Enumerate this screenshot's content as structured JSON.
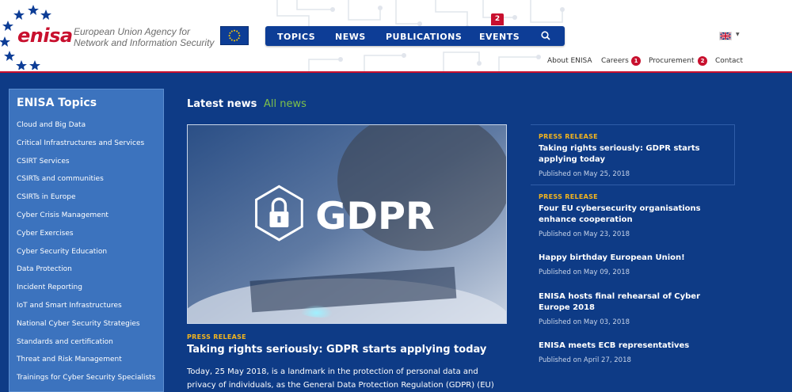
{
  "header": {
    "logo_text": "enisa",
    "tagline_line1": "European Union Agency for",
    "tagline_line2": "Network and Information Security",
    "nav": [
      {
        "label": "TOPICS"
      },
      {
        "label": "NEWS"
      },
      {
        "label": "PUBLICATIONS"
      },
      {
        "label": "EVENTS",
        "badge": "2"
      }
    ],
    "util_nav": [
      {
        "label": "About ENISA"
      },
      {
        "label": "Careers",
        "badge": "1"
      },
      {
        "label": "Procurement",
        "badge": "2"
      },
      {
        "label": "Contact"
      }
    ]
  },
  "sidebar": {
    "title": "ENISA Topics",
    "items": [
      "Cloud and Big Data",
      "Critical Infrastructures and Services",
      "CSIRT Services",
      "CSIRTs and communities",
      "CSIRTs in Europe",
      "Cyber Crisis Management",
      "Cyber Exercises",
      "Cyber Security Education",
      "Data Protection",
      "Incident Reporting",
      "IoT and Smart Infrastructures",
      "National Cyber Security Strategies",
      "Standards and certification",
      "Threat and Risk Management",
      "Trainings for Cyber Security Specialists"
    ]
  },
  "latest": {
    "title": "Latest news",
    "all_news_label": "All news",
    "hero_image_text": "GDPR",
    "hero_tag": "PRESS RELEASE",
    "hero_title": "Taking rights seriously: GDPR starts applying today",
    "hero_text": "Today, 25 May 2018, is a landmark in the protection of personal data and privacy of individuals, as the General Data Protection Regulation (GDPR) (EU)"
  },
  "news": [
    {
      "tag": "PRESS RELEASE",
      "title": "Taking rights seriously: GDPR starts applying today",
      "date": "Published on May 25, 2018"
    },
    {
      "tag": "PRESS RELEASE",
      "title": "Four EU cybersecurity organisations enhance cooperation",
      "date": "Published on May 23, 2018"
    },
    {
      "tag": "",
      "title": "Happy birthday European Union!",
      "date": "Published on May 09, 2018"
    },
    {
      "tag": "",
      "title": "ENISA hosts final rehearsal of Cyber Europe 2018",
      "date": "Published on May 03, 2018"
    },
    {
      "tag": "",
      "title": "ENISA meets ECB representatives",
      "date": "Published on April 27, 2018"
    }
  ],
  "colors": {
    "brand_red": "#c8102e",
    "nav_blue": "#0d3d96",
    "page_blue": "#0e3b86",
    "sidebar_blue": "#3c73be",
    "accent_green": "#7ec14a",
    "tag_yellow": "#f3b51d"
  }
}
